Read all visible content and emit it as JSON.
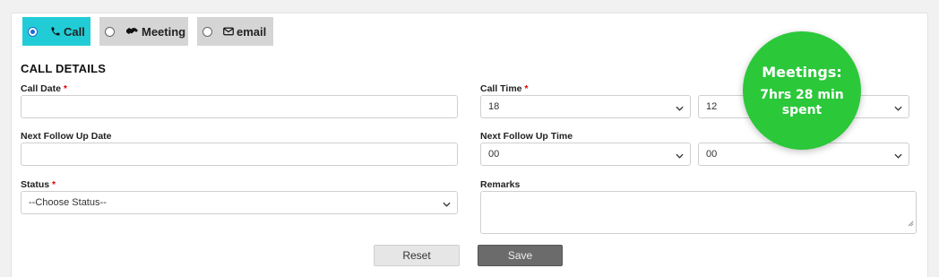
{
  "tabs": [
    {
      "label": "Call",
      "icon": "phone-icon",
      "selected": true
    },
    {
      "label": "Meeting",
      "icon": "handshake-icon",
      "selected": false
    },
    {
      "label": "email",
      "icon": "envelope-icon",
      "selected": false
    }
  ],
  "section_title": "CALL DETAILS",
  "fields": {
    "call_date": {
      "label": "Call Date",
      "required_mark": "*",
      "value": ""
    },
    "call_time": {
      "label": "Call Time",
      "required_mark": "*",
      "hour": "18",
      "minute": "12"
    },
    "next_follow_up_date": {
      "label": "Next Follow Up Date",
      "value": ""
    },
    "next_follow_up_time": {
      "label": "Next Follow Up Time",
      "hour": "00",
      "minute": "00"
    },
    "status": {
      "label": "Status",
      "required_mark": "*",
      "selected": "--Choose Status--"
    },
    "remarks": {
      "label": "Remarks",
      "value": ""
    }
  },
  "buttons": {
    "reset": "Reset",
    "save": "Save"
  },
  "badge": {
    "title": "Meetings:",
    "line1": "7hrs 28 min",
    "line2": "spent"
  },
  "colors": {
    "active_tab": "#22ccd6",
    "inactive_tab": "#d5d5d5",
    "badge": "#2bc83a",
    "required": "#dd0000",
    "save_button": "#6b6b6b"
  }
}
